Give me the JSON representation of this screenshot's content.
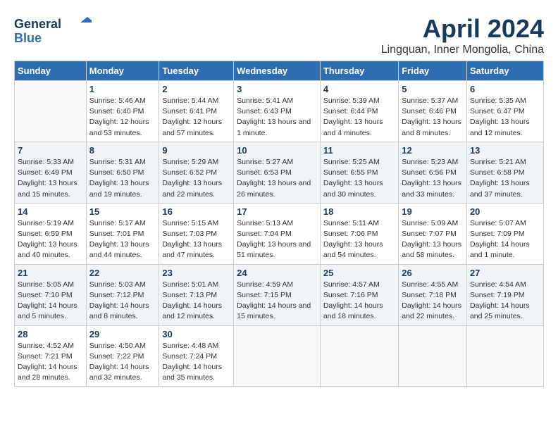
{
  "header": {
    "logo_line1": "General",
    "logo_line2": "Blue",
    "month": "April 2024",
    "location": "Lingquan, Inner Mongolia, China"
  },
  "weekdays": [
    "Sunday",
    "Monday",
    "Tuesday",
    "Wednesday",
    "Thursday",
    "Friday",
    "Saturday"
  ],
  "weeks": [
    [
      {
        "day": "",
        "info": ""
      },
      {
        "day": "1",
        "info": "Sunrise: 5:46 AM\nSunset: 6:40 PM\nDaylight: 12 hours\nand 53 minutes."
      },
      {
        "day": "2",
        "info": "Sunrise: 5:44 AM\nSunset: 6:41 PM\nDaylight: 12 hours\nand 57 minutes."
      },
      {
        "day": "3",
        "info": "Sunrise: 5:41 AM\nSunset: 6:43 PM\nDaylight: 13 hours\nand 1 minute."
      },
      {
        "day": "4",
        "info": "Sunrise: 5:39 AM\nSunset: 6:44 PM\nDaylight: 13 hours\nand 4 minutes."
      },
      {
        "day": "5",
        "info": "Sunrise: 5:37 AM\nSunset: 6:46 PM\nDaylight: 13 hours\nand 8 minutes."
      },
      {
        "day": "6",
        "info": "Sunrise: 5:35 AM\nSunset: 6:47 PM\nDaylight: 13 hours\nand 12 minutes."
      }
    ],
    [
      {
        "day": "7",
        "info": "Sunrise: 5:33 AM\nSunset: 6:49 PM\nDaylight: 13 hours\nand 15 minutes."
      },
      {
        "day": "8",
        "info": "Sunrise: 5:31 AM\nSunset: 6:50 PM\nDaylight: 13 hours\nand 19 minutes."
      },
      {
        "day": "9",
        "info": "Sunrise: 5:29 AM\nSunset: 6:52 PM\nDaylight: 13 hours\nand 22 minutes."
      },
      {
        "day": "10",
        "info": "Sunrise: 5:27 AM\nSunset: 6:53 PM\nDaylight: 13 hours\nand 26 minutes."
      },
      {
        "day": "11",
        "info": "Sunrise: 5:25 AM\nSunset: 6:55 PM\nDaylight: 13 hours\nand 30 minutes."
      },
      {
        "day": "12",
        "info": "Sunrise: 5:23 AM\nSunset: 6:56 PM\nDaylight: 13 hours\nand 33 minutes."
      },
      {
        "day": "13",
        "info": "Sunrise: 5:21 AM\nSunset: 6:58 PM\nDaylight: 13 hours\nand 37 minutes."
      }
    ],
    [
      {
        "day": "14",
        "info": "Sunrise: 5:19 AM\nSunset: 6:59 PM\nDaylight: 13 hours\nand 40 minutes."
      },
      {
        "day": "15",
        "info": "Sunrise: 5:17 AM\nSunset: 7:01 PM\nDaylight: 13 hours\nand 44 minutes."
      },
      {
        "day": "16",
        "info": "Sunrise: 5:15 AM\nSunset: 7:03 PM\nDaylight: 13 hours\nand 47 minutes."
      },
      {
        "day": "17",
        "info": "Sunrise: 5:13 AM\nSunset: 7:04 PM\nDaylight: 13 hours\nand 51 minutes."
      },
      {
        "day": "18",
        "info": "Sunrise: 5:11 AM\nSunset: 7:06 PM\nDaylight: 13 hours\nand 54 minutes."
      },
      {
        "day": "19",
        "info": "Sunrise: 5:09 AM\nSunset: 7:07 PM\nDaylight: 13 hours\nand 58 minutes."
      },
      {
        "day": "20",
        "info": "Sunrise: 5:07 AM\nSunset: 7:09 PM\nDaylight: 14 hours\nand 1 minute."
      }
    ],
    [
      {
        "day": "21",
        "info": "Sunrise: 5:05 AM\nSunset: 7:10 PM\nDaylight: 14 hours\nand 5 minutes."
      },
      {
        "day": "22",
        "info": "Sunrise: 5:03 AM\nSunset: 7:12 PM\nDaylight: 14 hours\nand 8 minutes."
      },
      {
        "day": "23",
        "info": "Sunrise: 5:01 AM\nSunset: 7:13 PM\nDaylight: 14 hours\nand 12 minutes."
      },
      {
        "day": "24",
        "info": "Sunrise: 4:59 AM\nSunset: 7:15 PM\nDaylight: 14 hours\nand 15 minutes."
      },
      {
        "day": "25",
        "info": "Sunrise: 4:57 AM\nSunset: 7:16 PM\nDaylight: 14 hours\nand 18 minutes."
      },
      {
        "day": "26",
        "info": "Sunrise: 4:55 AM\nSunset: 7:18 PM\nDaylight: 14 hours\nand 22 minutes."
      },
      {
        "day": "27",
        "info": "Sunrise: 4:54 AM\nSunset: 7:19 PM\nDaylight: 14 hours\nand 25 minutes."
      }
    ],
    [
      {
        "day": "28",
        "info": "Sunrise: 4:52 AM\nSunset: 7:21 PM\nDaylight: 14 hours\nand 28 minutes."
      },
      {
        "day": "29",
        "info": "Sunrise: 4:50 AM\nSunset: 7:22 PM\nDaylight: 14 hours\nand 32 minutes."
      },
      {
        "day": "30",
        "info": "Sunrise: 4:48 AM\nSunset: 7:24 PM\nDaylight: 14 hours\nand 35 minutes."
      },
      {
        "day": "",
        "info": ""
      },
      {
        "day": "",
        "info": ""
      },
      {
        "day": "",
        "info": ""
      },
      {
        "day": "",
        "info": ""
      }
    ]
  ]
}
